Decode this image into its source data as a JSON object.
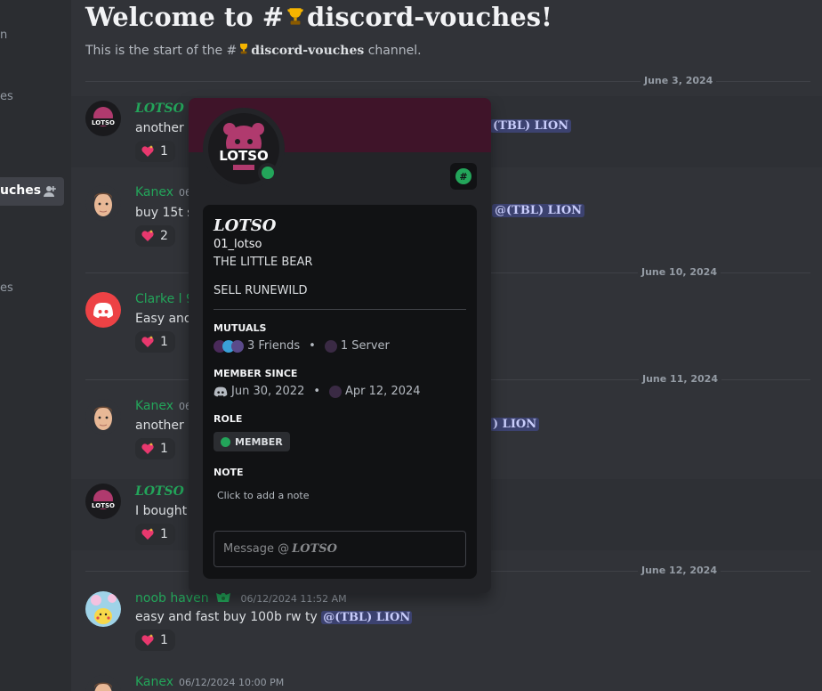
{
  "sidebar": {
    "items": [
      {
        "label": "n"
      },
      {
        "label": "es"
      },
      {
        "label": "uches"
      },
      {
        "label": "es"
      }
    ]
  },
  "channel": {
    "welcome_prefix": "Welcome to #",
    "name": "discord-vouches",
    "welcome_suffix": "!",
    "subtitle_prefix": "This is the start of the #",
    "subtitle_suffix": " channel."
  },
  "dates": [
    "June 3, 2024",
    "June 10, 2024",
    "June 11, 2024",
    "June 12, 2024"
  ],
  "messages": [
    {
      "user": "LOTSO",
      "text": "another s",
      "mention": "(TBL) LION",
      "reaction": "1"
    },
    {
      "user": "Kanex",
      "time": "06",
      "text": "buy 15t s",
      "mention": "@(TBL) LION",
      "reaction": "2"
    },
    {
      "user": "Clarke l 9",
      "text": "Easy and",
      "reaction": "1"
    },
    {
      "user": "Kanex",
      "time": "06",
      "text": "another s",
      "mention": ") LION",
      "reaction": "1"
    },
    {
      "user": "LOTSO",
      "text": "I bought c",
      "reaction": "1"
    },
    {
      "user": "noob haven",
      "time": "06/12/2024 11:52 AM",
      "text": "easy and fast buy 100b rw ty ",
      "mention": "@(TBL) LION",
      "reaction": "1"
    },
    {
      "user": "Kanex",
      "time": "06/12/2024 10:00 PM"
    }
  ],
  "profile": {
    "display_name": "LOTSO",
    "username": "01_lotso",
    "bio_line1": "THE LITTLE BEAR",
    "bio_line2": "SELL RUNEWILD",
    "mutuals_title": "MUTUALS",
    "mutual_friends": "3 Friends",
    "mutual_servers": "1 Server",
    "member_since_title": "MEMBER SINCE",
    "discord_since": "Jun 30, 2022",
    "server_since": "Apr 12, 2024",
    "role_title": "ROLE",
    "role_name": "MEMBER",
    "note_title": "NOTE",
    "note_placeholder": "Click to add a note",
    "message_placeholder": "Message @",
    "message_target": "LOTSO",
    "badge_symbol": "#"
  },
  "colors": {
    "online": "#23a55a",
    "banner": "#3f1429",
    "mention_bg": "#3c4270",
    "username_green": "#23a55a"
  }
}
